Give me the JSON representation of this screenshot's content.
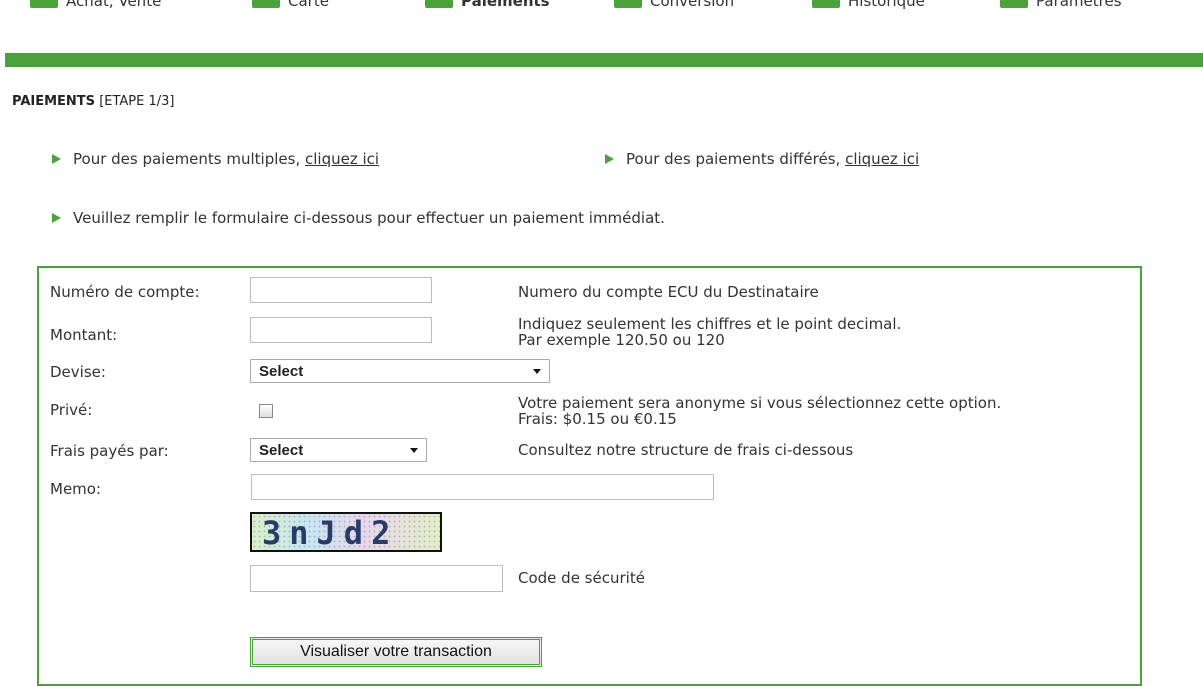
{
  "nav": {
    "items": [
      {
        "label": "Achat, Vente"
      },
      {
        "label": "Carte"
      },
      {
        "label": "Paiements"
      },
      {
        "label": "Conversion"
      },
      {
        "label": "Historique"
      },
      {
        "label": "Paramètres"
      }
    ],
    "accent_color": "#4ba13a"
  },
  "page": {
    "title": "PAIEMENTS",
    "step": "[ETAPE 1/3]"
  },
  "links": {
    "multiple_text": "Pour des paiements multiples,",
    "multiple_link": "cliquez ici",
    "deferred_text": "Pour des paiements différés,",
    "deferred_link": "cliquez ici",
    "instruction": "Veuillez remplir le formulaire ci-dessous pour effectuer un paiement immédiat."
  },
  "form": {
    "account_label": "Numéro de compte:",
    "account_value": "",
    "account_help": "Numero du compte ECU du Destinataire",
    "amount_label": "Montant:",
    "amount_value": "",
    "amount_help_1": "Indiquez seulement les chiffres et le point decimal.",
    "amount_help_2": "Par exemple 120.50 ou 120",
    "currency_label": "Devise:",
    "currency_value": "Select",
    "private_label": "Privé:",
    "private_checked": false,
    "private_help_1": "Votre paiement sera anonyme si vous sélectionnez cette option.",
    "private_help_2": "Frais: $0.15 ou €0.15",
    "fees_label": "Frais payés par:",
    "fees_value": "Select",
    "fees_help": "Consultez notre structure de frais ci-dessous",
    "memo_label": "Memo:",
    "memo_value": "",
    "captcha_text": "3nJd2",
    "security_code_value": "",
    "security_code_label": "Code de sécurité",
    "submit_label": "Visualiser votre transaction"
  }
}
